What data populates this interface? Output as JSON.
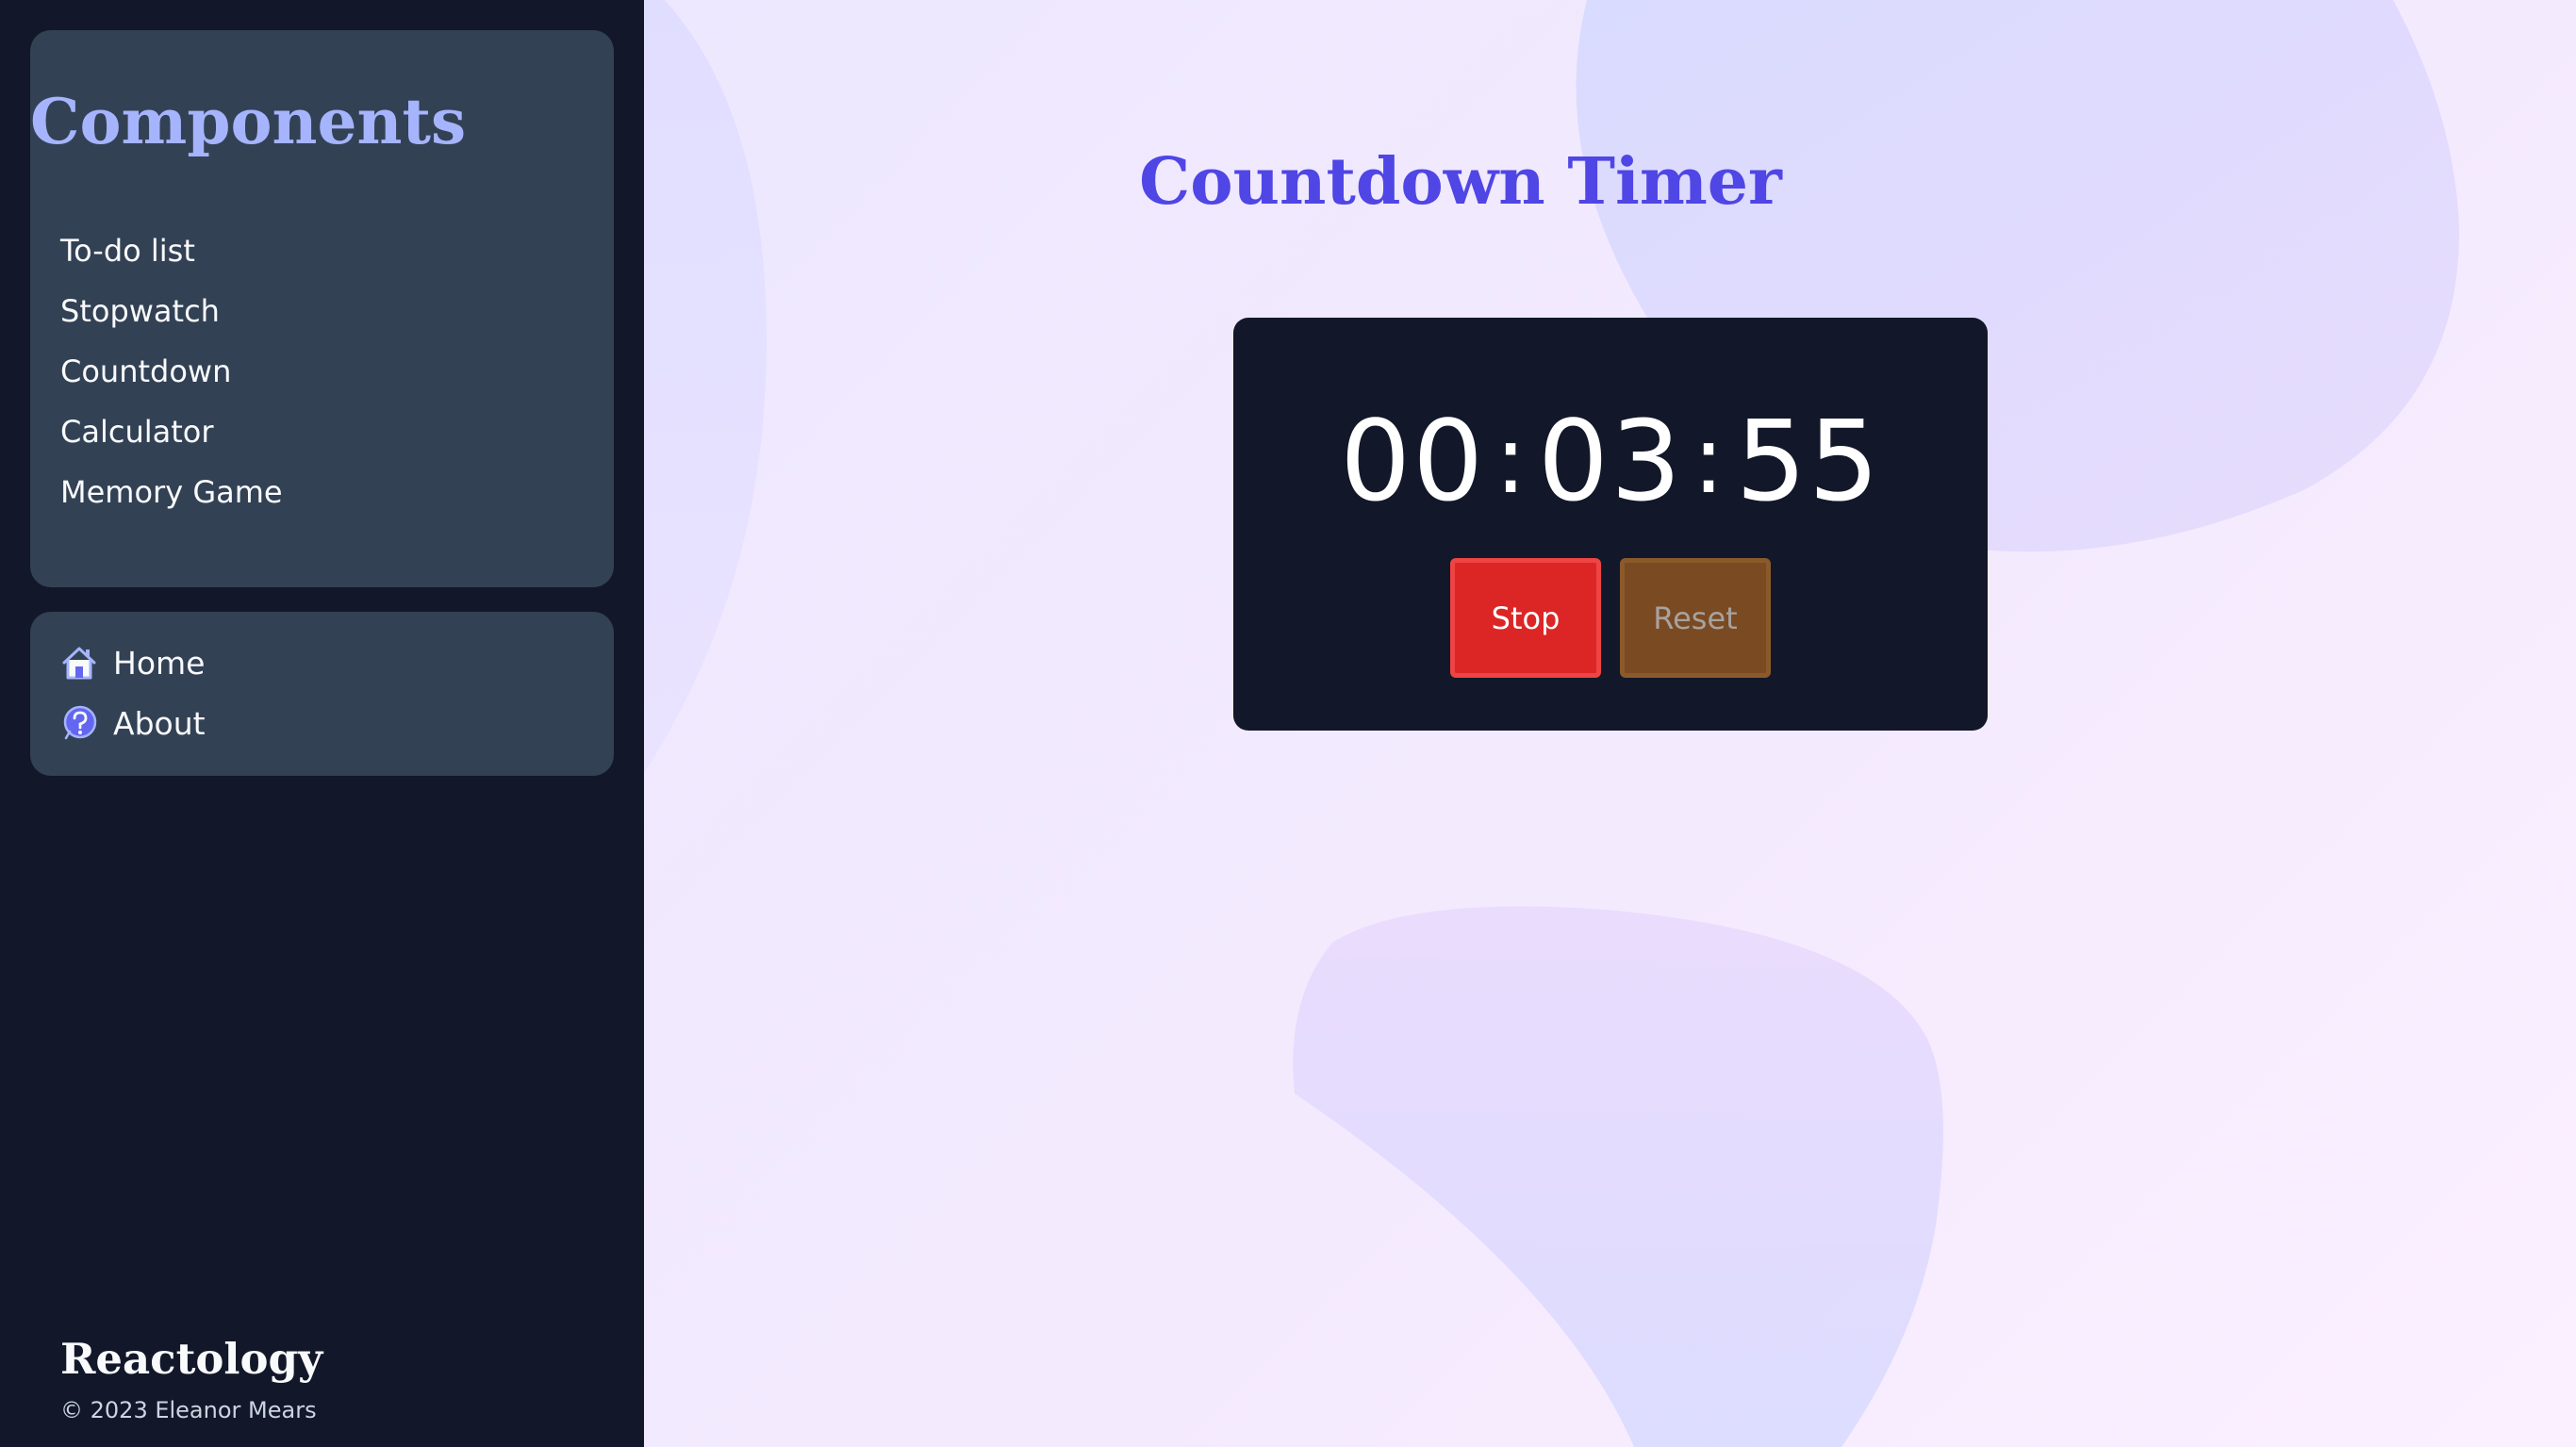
{
  "sidebar": {
    "components_title": "Components",
    "menu_items": [
      {
        "label": "To-do list"
      },
      {
        "label": "Stopwatch"
      },
      {
        "label": "Countdown"
      },
      {
        "label": "Calculator"
      },
      {
        "label": "Memory Game"
      }
    ],
    "nav_items": [
      {
        "label": "Home",
        "icon": "home-icon"
      },
      {
        "label": "About",
        "icon": "question-icon"
      }
    ],
    "brand": "Reactology",
    "copyright": "© 2023 Eleanor Mears"
  },
  "main": {
    "title": "Countdown Timer",
    "timer": {
      "hours": "00",
      "minutes": "03",
      "seconds": "55",
      "separator": ":"
    },
    "buttons": {
      "stop_label": "Stop",
      "reset_label": "Reset"
    }
  },
  "colors": {
    "sidebar_bg": "#121829",
    "panel_bg": "#334155",
    "accent_title": "#A5B4FC",
    "main_title": "#4F46E5",
    "stop_button": "#DC2626",
    "reset_button": "#7A4A22"
  }
}
